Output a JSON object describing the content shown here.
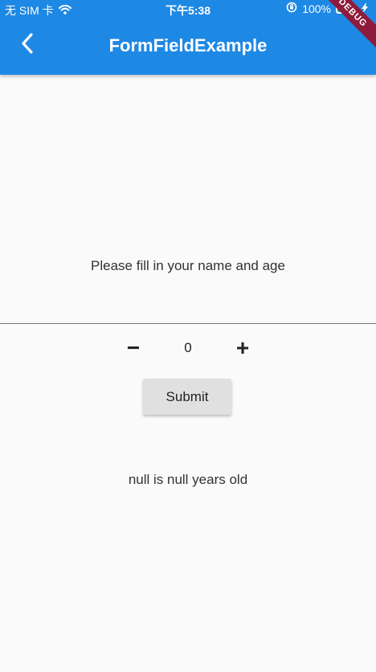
{
  "status": {
    "carrier": "无 SIM 卡",
    "time": "下午5:38",
    "battery": "100%"
  },
  "appbar": {
    "title": "FormFieldExample"
  },
  "form": {
    "helper": "Please fill in your name and age",
    "stepper": {
      "minus": "−",
      "value": "0",
      "plus": "+"
    },
    "submit": "Submit",
    "result": "null is null years old"
  },
  "debug": {
    "label": "DEBUG"
  },
  "colors": {
    "appbar": "#1e88e5",
    "ribbon": "#8e1b3b",
    "battery": "#34c759"
  }
}
